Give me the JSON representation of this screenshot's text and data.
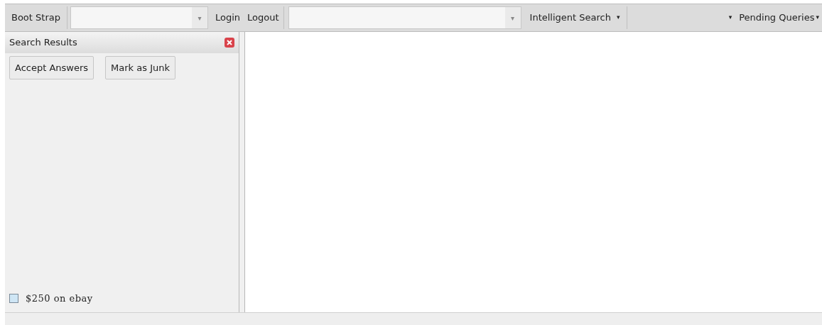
{
  "toolbar": {
    "title": "Boot Strap",
    "combo_1": {
      "arrow": "▾"
    },
    "buttons": [
      {
        "label": "Login"
      },
      {
        "label": "Logout"
      }
    ],
    "combo_2": {
      "arrow": "▾"
    },
    "menus": [
      {
        "label": "Intelligent Search",
        "trailing_arrow": "▾"
      },
      {
        "leading_arrow": "▾",
        "label": "Pending Queries",
        "trailing_arrow": "▾"
      }
    ]
  },
  "panel": {
    "title": "Search Results",
    "buttons": [
      {
        "label": "Accept Answers"
      },
      {
        "label": "Mark as Junk"
      }
    ],
    "results": [
      {
        "label": "$250 on ebay",
        "checked": false
      }
    ]
  }
}
